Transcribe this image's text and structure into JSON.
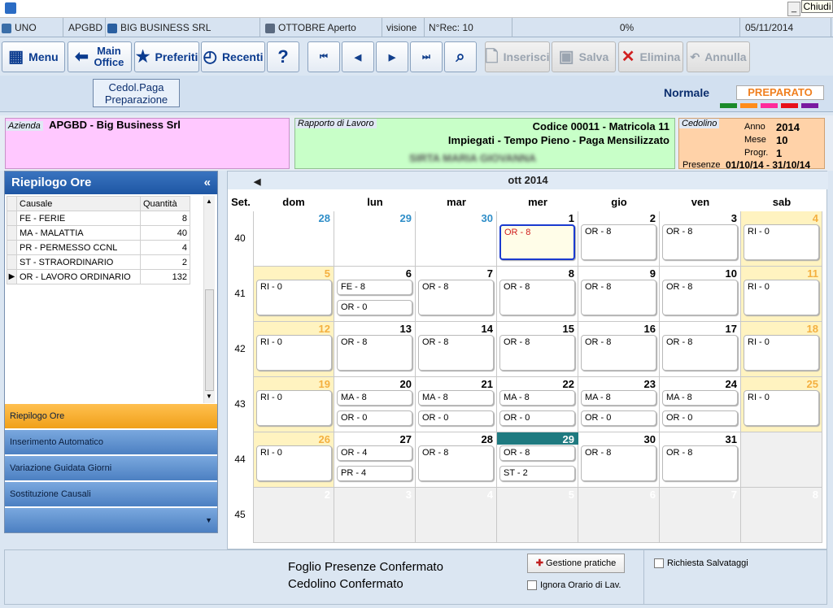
{
  "window": {
    "close_label": "Chiudi",
    "minimize_label": "_"
  },
  "statusbar": {
    "user": "UNO",
    "company_code": "APGBD",
    "company": "BIG BUSINESS SRL",
    "period": "OTTOBRE Aperto",
    "mode": "visione",
    "records": "N°Rec: 10",
    "progress": "0%",
    "date": "05/11/2014"
  },
  "toolbar": {
    "menu": "Menu",
    "main_office": "Main Office",
    "preferiti": "Preferiti",
    "recenti": "Recenti",
    "help": "?",
    "inserisci": "Inserisci",
    "salva": "Salva",
    "elimina": "Elimina",
    "annulla": "Annulla"
  },
  "subbar": {
    "cedol_button": "Cedol.Paga Preparazione",
    "mode": "Normale",
    "status": "PREPARATO",
    "swatches": [
      "#1a8a2a",
      "#ff8c1a",
      "#ff2a9a",
      "#e8101a",
      "#7a1aa0"
    ]
  },
  "info": {
    "azienda_label": "Azienda",
    "azienda_value": "APGBD - Big Business Srl",
    "rapporto_label": "Rapporto di Lavoro",
    "rapporto_line1": "Codice 00011 - Matricola 11",
    "rapporto_line2": "Impiegati - Tempo Pieno - Paga Mensilizzato",
    "rapporto_name": "SIRTA MARIA GIOVANNA",
    "cedolino_label": "Cedolino",
    "anno_label": "Anno",
    "anno": "2014",
    "mese_label": "Mese",
    "mese": "10",
    "progr_label": "Progr.",
    "progr": "1",
    "presenze_label": "Presenze",
    "presenze": "01/10/14 - 31/10/14"
  },
  "riepilogo": {
    "title": "Riepilogo Ore",
    "collapse": "«",
    "col_causale": "Causale",
    "col_quantita": "Quantità",
    "rows": [
      {
        "causale": "FE - FERIE",
        "qta": "8"
      },
      {
        "causale": "MA - MALATTIA",
        "qta": "40"
      },
      {
        "causale": "PR - PERMESSO CCNL",
        "qta": "4"
      },
      {
        "causale": "ST - STRAORDINARIO",
        "qta": "2"
      },
      {
        "causale": "OR - LAVORO ORDINARIO",
        "qta": "132"
      }
    ]
  },
  "leftmenu": [
    "Riepilogo Ore",
    "Inserimento Automatico",
    "Variazione Guidata Giorni",
    "Sostituzione Causali"
  ],
  "calendar": {
    "month_label": "ott 2014",
    "week_col": "Set.",
    "days": [
      "dom",
      "lun",
      "mar",
      "mer",
      "gio",
      "ven",
      "sab"
    ],
    "weeks": [
      {
        "num": "40",
        "cells": [
          {
            "d": "28",
            "t": "prev",
            "e": []
          },
          {
            "d": "29",
            "t": "prev",
            "e": []
          },
          {
            "d": "30",
            "t": "prev",
            "e": []
          },
          {
            "d": "1",
            "t": "sel",
            "e": [
              "OR - 8"
            ]
          },
          {
            "d": "2",
            "t": "n",
            "e": [
              "OR - 8"
            ]
          },
          {
            "d": "3",
            "t": "n",
            "e": [
              "OR - 8"
            ]
          },
          {
            "d": "4",
            "t": "we",
            "e": [
              "RI - 0"
            ]
          }
        ]
      },
      {
        "num": "41",
        "cells": [
          {
            "d": "5",
            "t": "we",
            "e": [
              "RI - 0"
            ]
          },
          {
            "d": "6",
            "t": "n",
            "e": [
              "FE - 8",
              "OR - 0"
            ]
          },
          {
            "d": "7",
            "t": "n",
            "e": [
              "OR - 8"
            ]
          },
          {
            "d": "8",
            "t": "n",
            "e": [
              "OR - 8"
            ]
          },
          {
            "d": "9",
            "t": "n",
            "e": [
              "OR - 8"
            ]
          },
          {
            "d": "10",
            "t": "n",
            "e": [
              "OR - 8"
            ]
          },
          {
            "d": "11",
            "t": "we",
            "e": [
              "RI - 0"
            ]
          }
        ]
      },
      {
        "num": "42",
        "cells": [
          {
            "d": "12",
            "t": "we",
            "e": [
              "RI - 0"
            ]
          },
          {
            "d": "13",
            "t": "n",
            "e": [
              "OR - 8"
            ]
          },
          {
            "d": "14",
            "t": "n",
            "e": [
              "OR - 8"
            ]
          },
          {
            "d": "15",
            "t": "n",
            "e": [
              "OR - 8"
            ]
          },
          {
            "d": "16",
            "t": "n",
            "e": [
              "OR - 8"
            ]
          },
          {
            "d": "17",
            "t": "n",
            "e": [
              "OR - 8"
            ]
          },
          {
            "d": "18",
            "t": "we",
            "e": [
              "RI - 0"
            ]
          }
        ]
      },
      {
        "num": "43",
        "cells": [
          {
            "d": "19",
            "t": "we",
            "e": [
              "RI - 0"
            ]
          },
          {
            "d": "20",
            "t": "n",
            "e": [
              "MA - 8",
              "OR - 0"
            ]
          },
          {
            "d": "21",
            "t": "n",
            "e": [
              "MA - 8",
              "OR - 0"
            ]
          },
          {
            "d": "22",
            "t": "n",
            "e": [
              "MA - 8",
              "OR - 0"
            ]
          },
          {
            "d": "23",
            "t": "n",
            "e": [
              "MA - 8",
              "OR - 0"
            ]
          },
          {
            "d": "24",
            "t": "n",
            "e": [
              "MA - 8",
              "OR - 0"
            ]
          },
          {
            "d": "25",
            "t": "we",
            "e": [
              "RI - 0"
            ]
          }
        ]
      },
      {
        "num": "44",
        "cells": [
          {
            "d": "26",
            "t": "we",
            "e": [
              "RI - 0"
            ]
          },
          {
            "d": "27",
            "t": "n",
            "e": [
              "OR - 4",
              "PR - 4"
            ]
          },
          {
            "d": "28",
            "t": "n",
            "e": [
              "OR - 8"
            ]
          },
          {
            "d": "29",
            "t": "today",
            "e": [
              "OR - 8",
              "ST - 2"
            ]
          },
          {
            "d": "30",
            "t": "n",
            "e": [
              "OR - 8"
            ]
          },
          {
            "d": "31",
            "t": "n",
            "e": [
              "OR - 8"
            ]
          },
          {
            "d": "",
            "t": "out",
            "e": []
          }
        ]
      },
      {
        "num": "45",
        "cells": [
          {
            "d": "2",
            "t": "next",
            "e": []
          },
          {
            "d": "3",
            "t": "next",
            "e": []
          },
          {
            "d": "4",
            "t": "next",
            "e": []
          },
          {
            "d": "5",
            "t": "next",
            "e": []
          },
          {
            "d": "6",
            "t": "next",
            "e": []
          },
          {
            "d": "7",
            "t": "next",
            "e": []
          },
          {
            "d": "8",
            "t": "next",
            "e": []
          }
        ]
      }
    ]
  },
  "bottom": {
    "line1": "Foglio Presenze Confermato",
    "line2": "Cedolino Confermato",
    "gestione": "Gestione pratiche",
    "ignora": "Ignora Orario di Lav.",
    "richiesta": "Richiesta Salvataggi"
  }
}
